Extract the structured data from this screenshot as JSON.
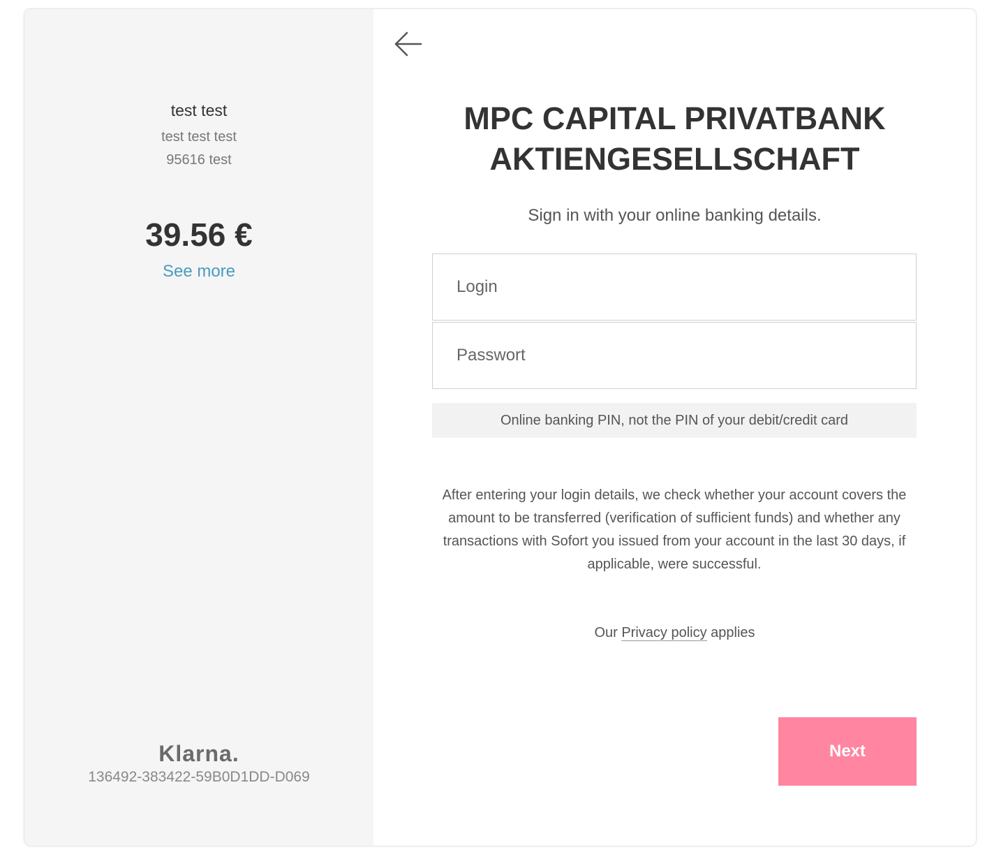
{
  "order_summary": {
    "customer_name": "test test",
    "address_line1": "test test test",
    "address_line2": "95616 test",
    "amount": "39.56 €",
    "see_more_label": "See more",
    "brand": "Klarna.",
    "transaction_id": "136492-383422-59B0D1DD-D069"
  },
  "login_form": {
    "back_icon": "arrow-left-icon",
    "bank_name_line1": "MPC CAPITAL PRIVATBANK",
    "bank_name_line2": "AKTIENGESELLSCHAFT",
    "subtitle": "Sign in with your online banking details.",
    "login_placeholder": "Login",
    "password_placeholder": "Passwort",
    "pin_hint": "Online banking PIN, not the PIN of your debit/credit card",
    "info_text": "After entering your login details, we check whether your account covers the amount to be transferred (verification of sufficient funds) and whether any transactions with Sofort you issued from your account in the last 30 days, if applicable, were successful.",
    "privacy_prefix": "Our",
    "privacy_link": "Privacy policy",
    "privacy_suffix": "applies",
    "next_label": "Next"
  },
  "colors": {
    "accent_pink": "#ff85a1",
    "link_blue": "#4a9bbf",
    "sidebar_bg": "#f5f5f5"
  }
}
